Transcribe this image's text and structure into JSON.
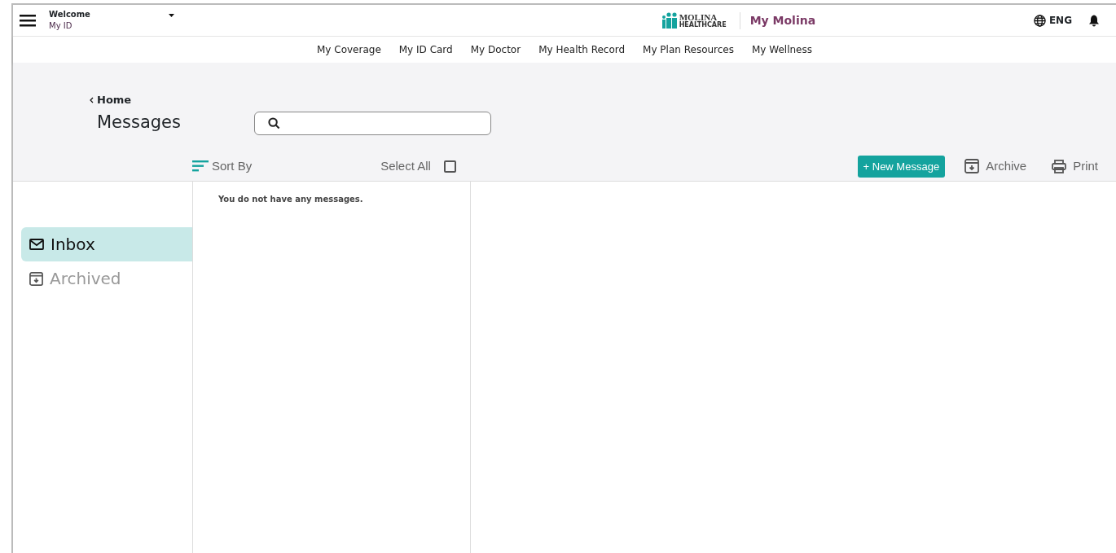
{
  "header": {
    "welcome": "Welcome",
    "user": "My ID",
    "logo_name": "MOLINA",
    "logo_sub": "HEALTHCARE",
    "portal": "My Molina",
    "language": "ENG"
  },
  "nav": [
    {
      "label": "My Coverage"
    },
    {
      "label": "My ID Card"
    },
    {
      "label": "My Doctor"
    },
    {
      "label": "My Health Record"
    },
    {
      "label": "My Plan Resources"
    },
    {
      "label": "My Wellness"
    }
  ],
  "breadcrumb": "Home",
  "title": "Messages",
  "toolbar": {
    "sort": "Sort By",
    "select_all": "Select All",
    "select_all_checked": false,
    "new_message": "+ New Message",
    "archive": "Archive",
    "print": "Print"
  },
  "folders": [
    {
      "label": "Inbox",
      "kind": "inbox",
      "selected": true
    },
    {
      "label": "Archived",
      "kind": "archive",
      "selected": false
    }
  ],
  "empty_text": "You do not have any messages."
}
